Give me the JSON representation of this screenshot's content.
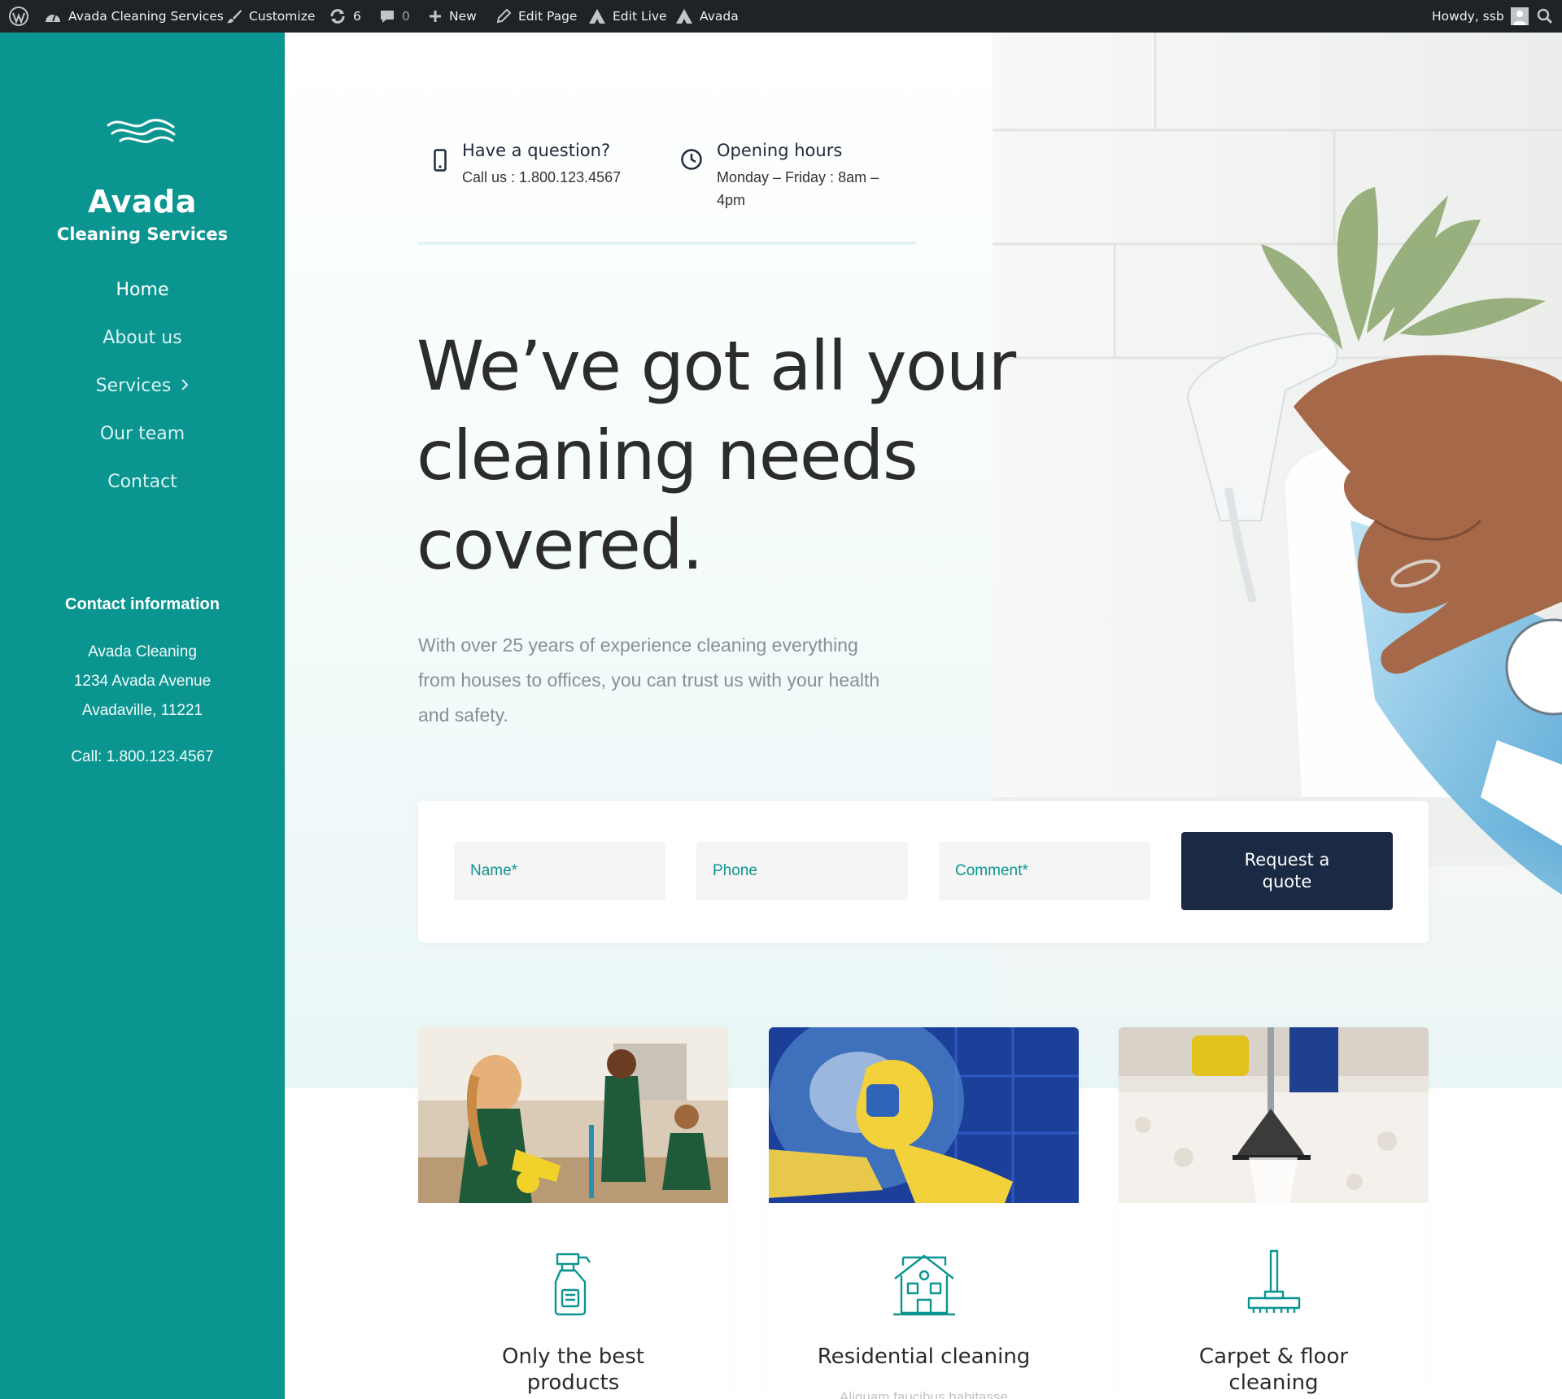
{
  "adminbar": {
    "site_name": "Avada Cleaning Services",
    "customize": "Customize",
    "updates_count": "6",
    "comments_count": "0",
    "new_label": "New",
    "edit_page": "Edit Page",
    "edit_live": "Edit Live",
    "avada": "Avada",
    "howdy": "Howdy, ssb"
  },
  "sidebar": {
    "logo_title": "Avada",
    "logo_subtitle": "Cleaning Services",
    "nav": [
      "Home",
      "About us",
      "Services",
      "Our team",
      "Contact"
    ],
    "contact_heading": "Contact information",
    "address": [
      "Avada Cleaning",
      "1234 Avada Avenue",
      "Avadaville, 11221"
    ],
    "phone": "Call: 1.800.123.4567"
  },
  "hero": {
    "question_title": "Have a question?",
    "question_text": "Call us : 1.800.123.4567",
    "hours_title": "Opening hours",
    "hours_line1": "Monday – Friday : 8am –",
    "hours_line2": "4pm",
    "headline_line1": "We’ve got all your",
    "headline_line2": "cleaning needs",
    "headline_line3": "covered.",
    "lead_line1": "With over 25 years of experience cleaning everything",
    "lead_line2": "from houses to offices, you can trust us with your health",
    "lead_line3": "and safety."
  },
  "form": {
    "name_placeholder": "Name*",
    "phone_placeholder": "Phone",
    "comment_placeholder": "Comment*",
    "submit_line1": "Request a",
    "submit_line2": "quote"
  },
  "cards": [
    {
      "title_line1": "Only the best",
      "title_line2": "products",
      "snippet": ""
    },
    {
      "title_line1": "Residential cleaning",
      "title_line2": "",
      "snippet": "Aliquam faucibus habitasse"
    },
    {
      "title_line1": "Carpet & floor",
      "title_line2": "cleaning",
      "snippet": ""
    }
  ],
  "colors": {
    "adminbar": "#1d2327",
    "brand_teal": "#0b9591",
    "button_navy": "#1b2a44",
    "headline": "#2c2c2c"
  },
  "icons": [
    "wordpress-icon",
    "dashboard-icon",
    "brush-icon",
    "updates-icon",
    "comments-icon",
    "plus-icon",
    "pencil-icon",
    "avada-icon",
    "avatar-icon",
    "search-icon",
    "phone-icon",
    "clock-icon",
    "chevron-right-icon",
    "spray-bottle-icon",
    "house-icon",
    "floor-mop-icon"
  ]
}
